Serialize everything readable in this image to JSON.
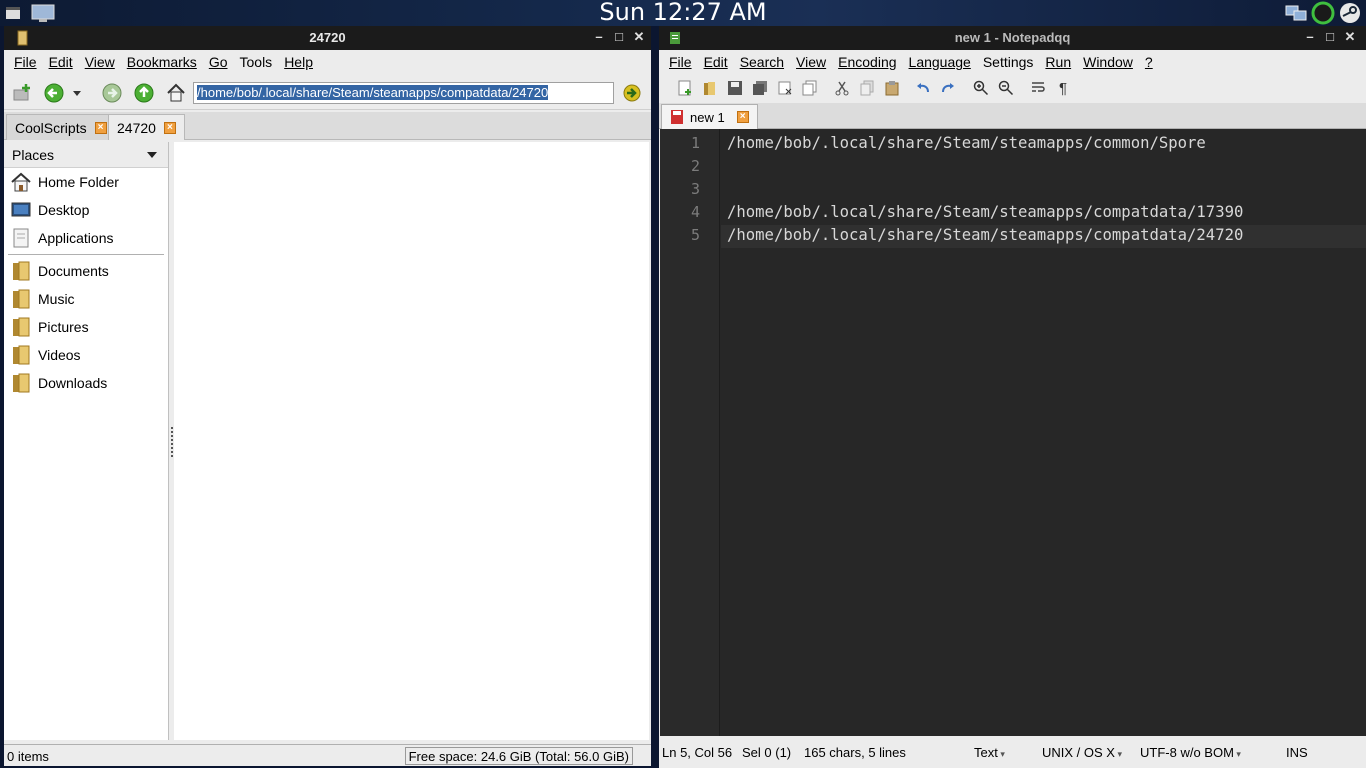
{
  "topbar": {
    "clock": "Sun 12:27 AM"
  },
  "filemanager": {
    "title": "24720",
    "menu": [
      "File",
      "Edit",
      "View",
      "Bookmarks",
      "Go",
      "Tools",
      "Help"
    ],
    "path": "/home/bob/.local/share/Steam/steamapps/compatdata/24720",
    "tabs": [
      {
        "label": "CoolScripts"
      },
      {
        "label": "24720"
      }
    ],
    "places_header": "Places",
    "places": [
      {
        "label": "Home Folder",
        "icon": "home-icon"
      },
      {
        "label": "Desktop",
        "icon": "desktop-icon"
      },
      {
        "label": "Applications",
        "icon": "applications-icon"
      }
    ],
    "bookmarks": [
      {
        "label": "Documents",
        "icon": "folder-icon"
      },
      {
        "label": "Music",
        "icon": "folder-icon"
      },
      {
        "label": "Pictures",
        "icon": "folder-icon"
      },
      {
        "label": "Videos",
        "icon": "folder-icon"
      },
      {
        "label": "Downloads",
        "icon": "folder-icon"
      }
    ],
    "status_items": "0 items",
    "status_free": "Free space: 24.6 GiB (Total: 56.0 GiB)"
  },
  "editor": {
    "title": "new 1 - Notepadqq",
    "menu": [
      "File",
      "Edit",
      "Search",
      "View",
      "Encoding",
      "Language",
      "Settings",
      "Run",
      "Window",
      "?"
    ],
    "tab_label": "new 1",
    "lines": [
      {
        "num": "1",
        "text": "/home/bob/.local/share/Steam/steamapps/common/Spore"
      },
      {
        "num": "2",
        "text": ""
      },
      {
        "num": "3",
        "text": ""
      },
      {
        "num": "4",
        "text": "/home/bob/.local/share/Steam/steamapps/compatdata/17390"
      },
      {
        "num": "5",
        "text": "/home/bob/.local/share/Steam/steamapps/compatdata/24720"
      }
    ],
    "status": {
      "position": "Ln 5, Col 56",
      "selection": "Sel 0 (1)",
      "stats": "165 chars, 5 lines",
      "language": "Text",
      "eol": "UNIX / OS X",
      "encoding": "UTF-8 w/o BOM",
      "mode": "INS"
    }
  },
  "colors": {
    "editor_bg": "#272727",
    "selection_bg": "#3465a4",
    "tab_close": "#f0a040"
  }
}
